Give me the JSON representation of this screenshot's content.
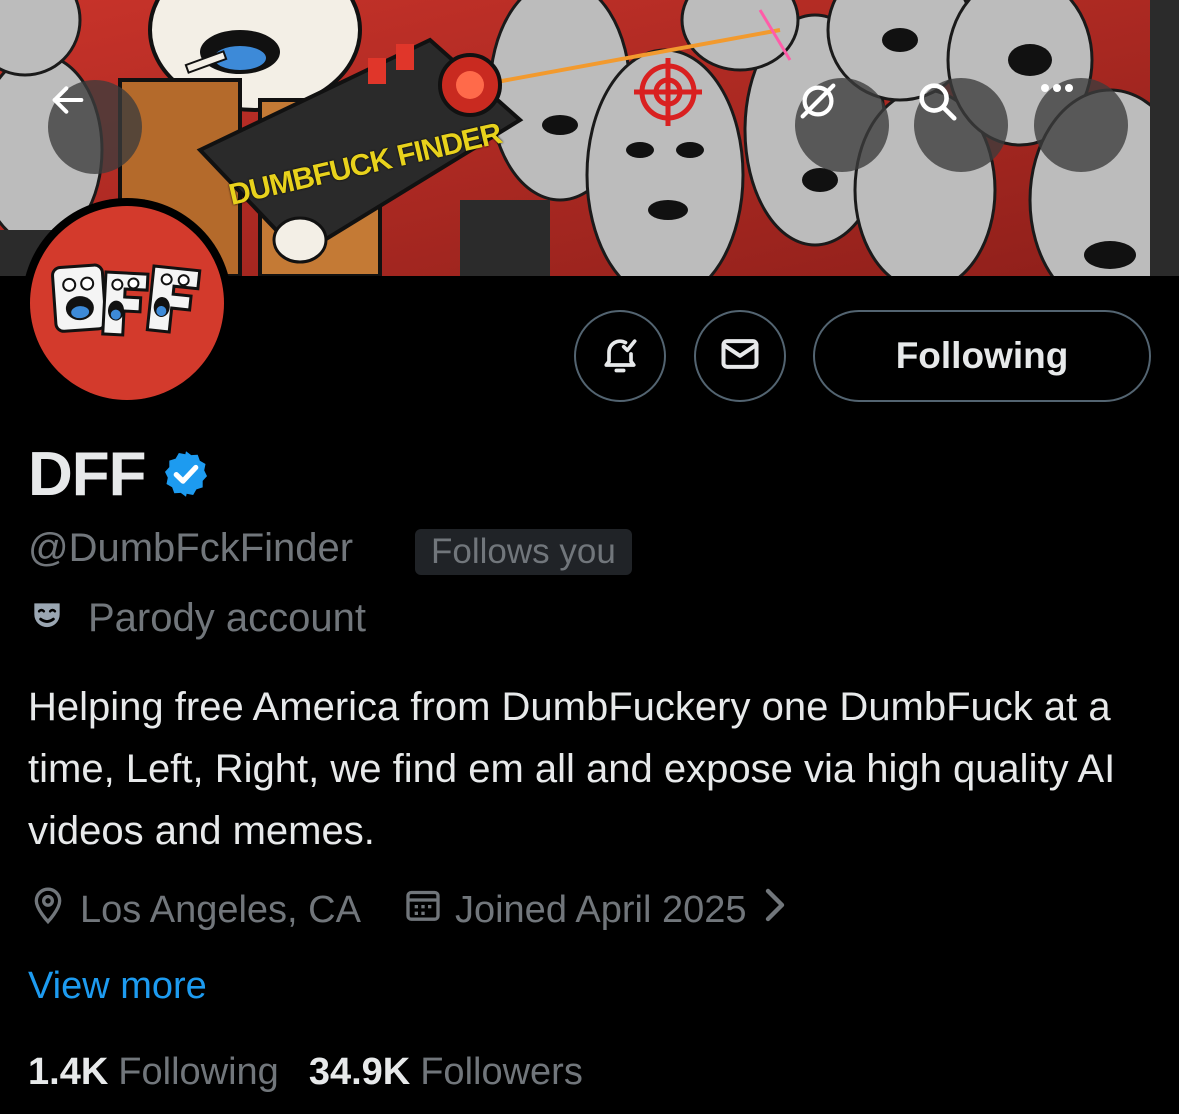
{
  "banner": {
    "caption": "DUMBFUCK FINDER"
  },
  "header": {
    "back_icon": "arrow-left-icon",
    "grok_icon": "grok-icon",
    "search_icon": "search-icon",
    "more_icon": "more-icon"
  },
  "avatar": {
    "letters": [
      "D",
      "F",
      "F"
    ]
  },
  "actions": {
    "notifications_icon": "bell-subscribed-icon",
    "message_icon": "mail-icon",
    "following_label": "Following"
  },
  "profile": {
    "display_name": "DFF",
    "handle": "@DumbFckFinder",
    "follows_you": "Follows you",
    "parody_label": "Parody account",
    "bio": "Helping free America from DumbFuckery one DumbFuck at a time, Left, Right, we find em all and expose via high quality AI videos and memes.",
    "location": "Los Angeles, CA",
    "joined": "Joined April 2025",
    "view_more": "View more"
  },
  "stats": {
    "following_count": "1.4K",
    "following_label": "Following",
    "followers_count": "34.9K",
    "followers_label": "Followers"
  },
  "colors": {
    "background": "#000000",
    "text_primary": "#e7e9ea",
    "text_secondary": "#71767b",
    "accent_blue": "#1d9bf0",
    "avatar_red": "#d33a2c",
    "border": "#536471"
  }
}
